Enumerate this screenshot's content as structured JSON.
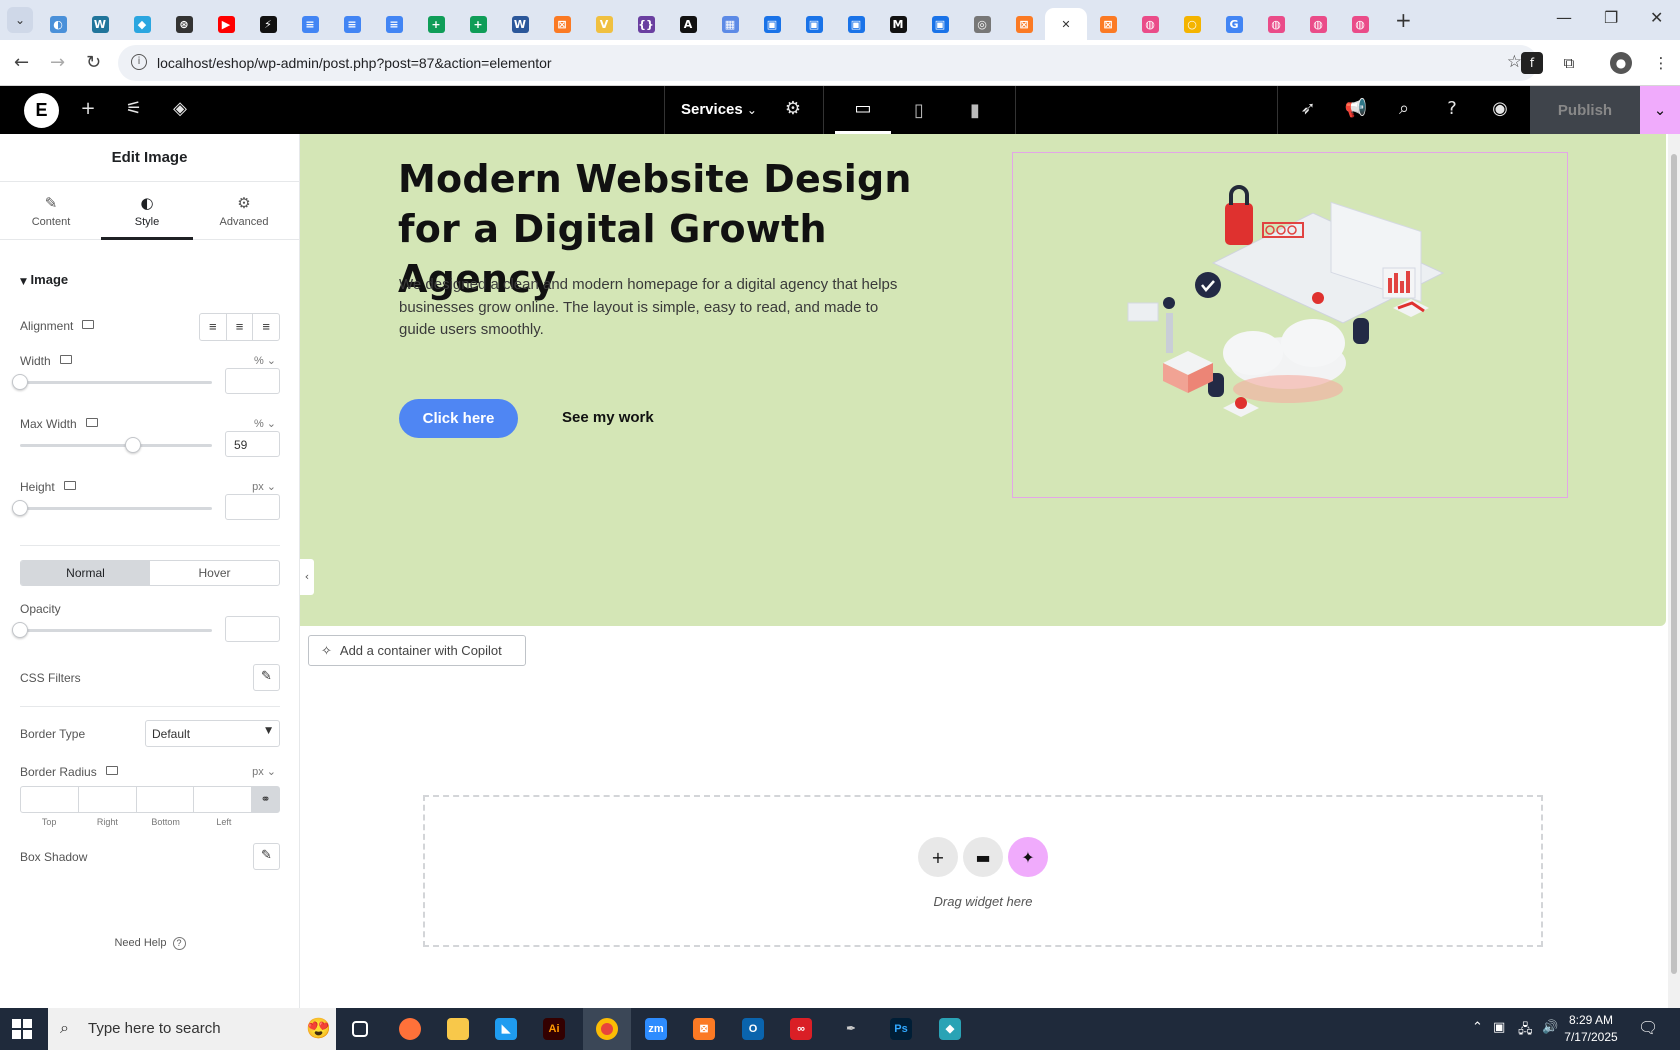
{
  "browser": {
    "url": "localhost/eshop/wp-admin/post.php?post=87&action=elementor",
    "tab_favicons": [
      {
        "icon": "edge-icon",
        "color": "#4a90d9",
        "glyph": "◐"
      },
      {
        "icon": "wordpress-icon",
        "color": "#21759b",
        "glyph": "W"
      },
      {
        "icon": "figma-like-icon",
        "color": "#2ba6e0",
        "glyph": "◆"
      },
      {
        "icon": "openai-icon",
        "color": "#333333",
        "glyph": "⊛"
      },
      {
        "icon": "youtube-icon",
        "color": "#ff0000",
        "glyph": "▶"
      },
      {
        "icon": "bolt-icon",
        "color": "#111111",
        "glyph": "⚡"
      },
      {
        "icon": "docs-icon",
        "color": "#4285f4",
        "glyph": "≡"
      },
      {
        "icon": "docs-icon",
        "color": "#4285f4",
        "glyph": "≡"
      },
      {
        "icon": "docs-icon",
        "color": "#4285f4",
        "glyph": "≡"
      },
      {
        "icon": "sheets-icon",
        "color": "#0f9d58",
        "glyph": "+"
      },
      {
        "icon": "sheets-icon",
        "color": "#0f9d58",
        "glyph": "+"
      },
      {
        "icon": "word-icon",
        "color": "#2b579a",
        "glyph": "W"
      },
      {
        "icon": "xampp-icon",
        "color": "#fb7a24",
        "glyph": "⊠"
      },
      {
        "icon": "vue-icon",
        "color": "#f0c040",
        "glyph": "V"
      },
      {
        "icon": "brackets-icon",
        "color": "#6a3fa0",
        "glyph": "{}"
      },
      {
        "icon": "a-icon",
        "color": "#111111",
        "glyph": "A"
      },
      {
        "icon": "grid-icon",
        "color": "#5c8ae6",
        "glyph": "▦"
      },
      {
        "icon": "forms-icon",
        "color": "#1a73e8",
        "glyph": "▣"
      },
      {
        "icon": "forms-icon",
        "color": "#1a73e8",
        "glyph": "▣"
      },
      {
        "icon": "forms-icon",
        "color": "#1a73e8",
        "glyph": "▣"
      },
      {
        "icon": "medium-icon",
        "color": "#111111",
        "glyph": "M"
      },
      {
        "icon": "forms-icon",
        "color": "#1a73e8",
        "glyph": "▣"
      },
      {
        "icon": "globe-icon",
        "color": "#777777",
        "glyph": "◎"
      },
      {
        "icon": "xampp-icon",
        "color": "#fb7a24",
        "glyph": "⊠"
      },
      {
        "icon": "close-icon",
        "color": "#ffffff",
        "glyph": "✕",
        "active": true
      },
      {
        "icon": "xampp-icon",
        "color": "#fb7a24",
        "glyph": "⊠"
      },
      {
        "icon": "dribbble-icon",
        "color": "#ea4c89",
        "glyph": "◍"
      },
      {
        "icon": "circle-icon",
        "color": "#f4b400",
        "glyph": "○"
      },
      {
        "icon": "google-icon",
        "color": "#4285f4",
        "glyph": "G"
      },
      {
        "icon": "dribbble-icon",
        "color": "#ea4c89",
        "glyph": "◍"
      },
      {
        "icon": "dribbble-icon",
        "color": "#ea4c89",
        "glyph": "◍"
      },
      {
        "icon": "dribbble-icon",
        "color": "#ea4c89",
        "glyph": "◍"
      }
    ]
  },
  "editor": {
    "page_selector": "Services",
    "publish_label": "Publish"
  },
  "panel": {
    "title": "Edit Image",
    "tabs": [
      {
        "label": "Content",
        "icon": "pencil-icon"
      },
      {
        "label": "Style",
        "icon": "half-circle-icon",
        "active": true
      },
      {
        "label": "Advanced",
        "icon": "gear-icon"
      }
    ],
    "section_title": "Image",
    "alignment_label": "Alignment",
    "width_label": "Width",
    "width_unit": "%",
    "width_value": "",
    "max_width_label": "Max Width",
    "max_width_unit": "%",
    "max_width_value": "59",
    "max_width_fraction": 0.59,
    "height_label": "Height",
    "height_unit": "px",
    "height_value": "",
    "state_normal": "Normal",
    "state_hover": "Hover",
    "opacity_label": "Opacity",
    "css_filters_label": "CSS Filters",
    "border_type_label": "Border Type",
    "border_type_value": "Default",
    "border_radius_label": "Border Radius",
    "border_radius_unit": "px",
    "radius_top": "Top",
    "radius_right": "Right",
    "radius_bottom": "Bottom",
    "radius_left": "Left",
    "box_shadow_label": "Box Shadow",
    "need_help": "Need Help"
  },
  "canvas": {
    "headline": "Modern Website Design for a Digital Growth Agency",
    "body": "We designed a clean and modern homepage for a digital agency that helps businesses grow online. The layout is simple, easy to read, and made to guide users smoothly.",
    "primary_button": "Click here",
    "secondary_button": "See my work",
    "copilot_button": "Add a container with Copilot",
    "drop_hint": "Drag widget here",
    "hero_bg": "#d4e6b6"
  },
  "taskbar": {
    "search_placeholder": "Type here to search",
    "time": "8:29 AM",
    "date": "7/17/2025"
  }
}
